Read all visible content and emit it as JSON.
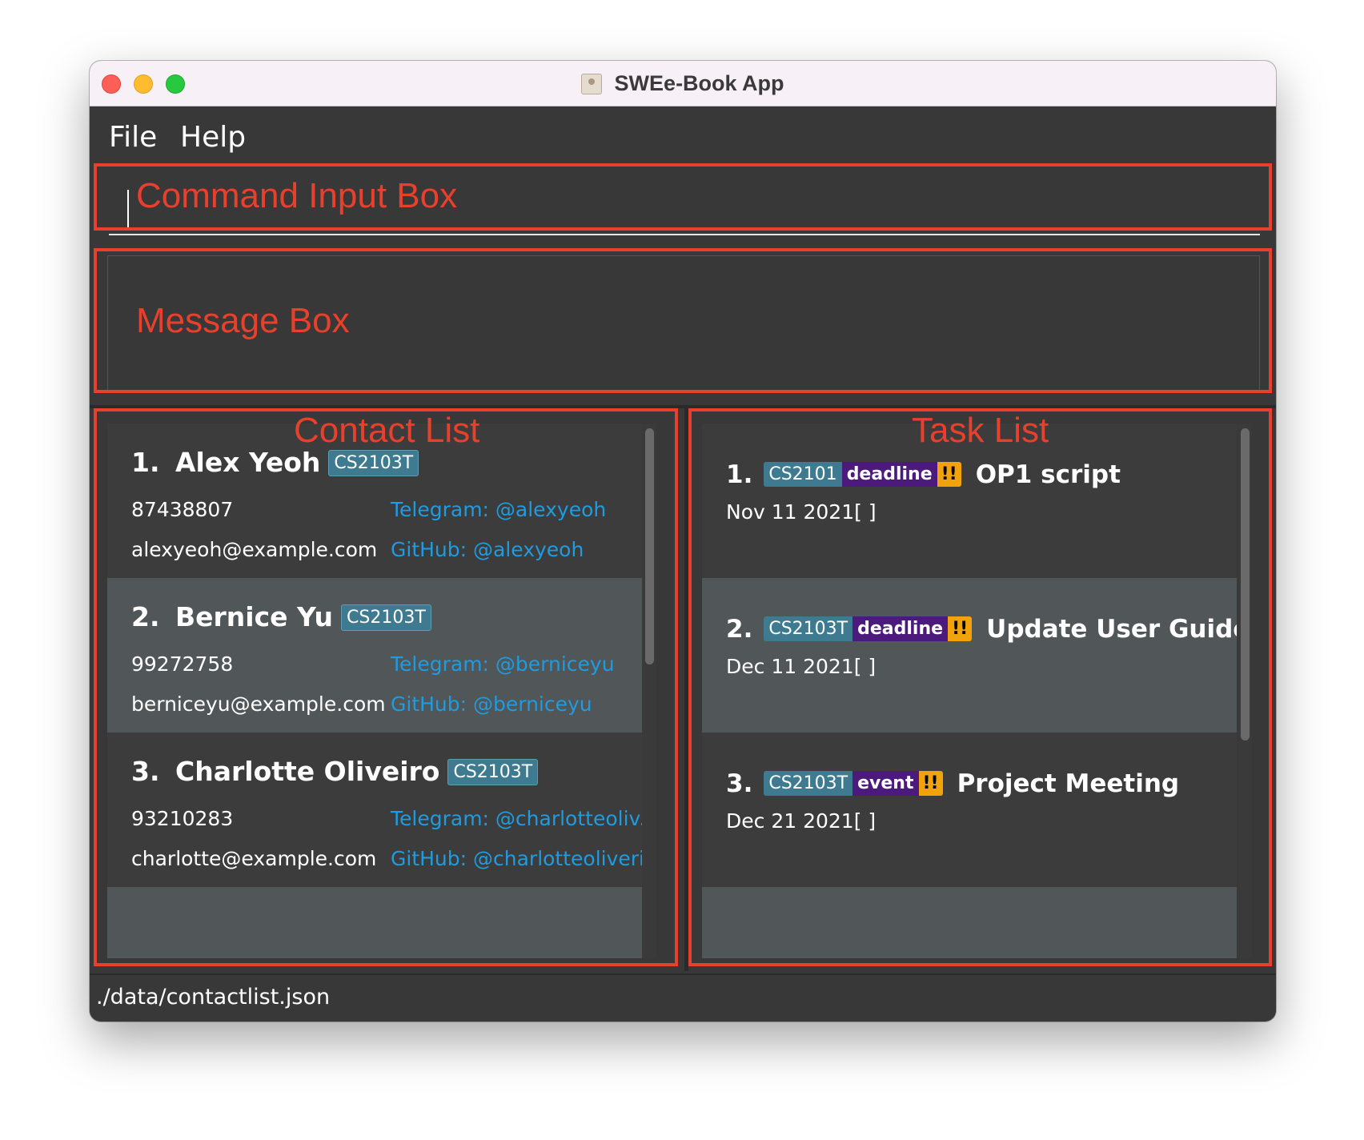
{
  "window": {
    "title": "SWEe-Book App",
    "icon": "address-book-icon"
  },
  "menu": {
    "items": [
      "File",
      "Help"
    ]
  },
  "command_box": {
    "value": ""
  },
  "overlay": {
    "color": "#e8402c",
    "labels": {
      "command": "Command Input Box",
      "message": "Message Box",
      "contacts": "Contact List",
      "tasks": "Task List"
    }
  },
  "contacts": [
    {
      "index": "1.",
      "name": "Alex Yeoh",
      "tag": "CS2103T",
      "phone": "87438807",
      "email": "alexyeoh@example.com",
      "telegram": "Telegram: @alexyeoh",
      "github": "GitHub: @alexyeoh"
    },
    {
      "index": "2.",
      "name": "Bernice Yu",
      "tag": "CS2103T",
      "phone": "99272758",
      "email": "berniceyu@example.com",
      "telegram": "Telegram: @berniceyu",
      "github": "GitHub: @berniceyu"
    },
    {
      "index": "3.",
      "name": "Charlotte Oliveiro",
      "tag": "CS2103T",
      "phone": "93210283",
      "email": "charlotte@example.com",
      "telegram": "Telegram: @charlotteoliv...",
      "github": "GitHub: @charlotteoliverio"
    }
  ],
  "tasks": [
    {
      "index": "1.",
      "module": "CS2101",
      "kind": "deadline",
      "priority": "!!",
      "name": "OP1 script",
      "date": "Nov 11 2021[ ]"
    },
    {
      "index": "2.",
      "module": "CS2103T",
      "kind": "deadline",
      "priority": "!!",
      "name": "Update User Guide",
      "date": "Dec 11 2021[ ]"
    },
    {
      "index": "3.",
      "module": "CS2103T",
      "kind": "event",
      "priority": "!!",
      "name": "Project Meeting",
      "date": "Dec 21 2021[ ]"
    }
  ],
  "status_bar": {
    "path": "./data/contactlist.json"
  },
  "colors": {
    "tag": "#3e7b91",
    "deadline": "#4b1a7c",
    "priority": "#f0a30a",
    "link": "#1f9bdf"
  }
}
